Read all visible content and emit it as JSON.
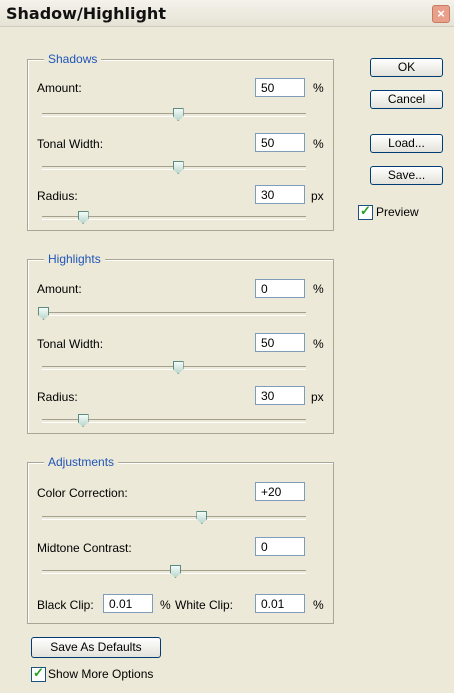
{
  "window": {
    "title": "Shadow/Highlight",
    "close": "×"
  },
  "buttons": {
    "ok": "OK",
    "cancel": "Cancel",
    "load": "Load...",
    "save": "Save..."
  },
  "preview": {
    "label": "Preview",
    "checked": true
  },
  "shadows": {
    "legend": "Shadows",
    "amount": {
      "label": "Amount:",
      "value": "50",
      "unit": "%",
      "slider": 0.51
    },
    "tonal_width": {
      "label": "Tonal Width:",
      "value": "50",
      "unit": "%",
      "slider": 0.51
    },
    "radius": {
      "label": "Radius:",
      "value": "30",
      "unit": "px",
      "slider": 0.15
    }
  },
  "highlights": {
    "legend": "Highlights",
    "amount": {
      "label": "Amount:",
      "value": "0",
      "unit": "%",
      "slider": 0.0
    },
    "tonal_width": {
      "label": "Tonal Width:",
      "value": "50",
      "unit": "%",
      "slider": 0.51
    },
    "radius": {
      "label": "Radius:",
      "value": "30",
      "unit": "px",
      "slider": 0.15
    }
  },
  "adjustments": {
    "legend": "Adjustments",
    "color_correction": {
      "label": "Color Correction:",
      "value": "+20",
      "slider": 0.6
    },
    "midtone_contrast": {
      "label": "Midtone Contrast:",
      "value": "0",
      "slider": 0.5
    },
    "black_clip": {
      "label": "Black Clip:",
      "value": "0.01",
      "unit": "%"
    },
    "white_clip": {
      "label": "White Clip:",
      "value": "0.01",
      "unit": "%"
    }
  },
  "save_defaults": "Save As Defaults",
  "show_more": {
    "label": "Show More Options",
    "checked": true
  }
}
